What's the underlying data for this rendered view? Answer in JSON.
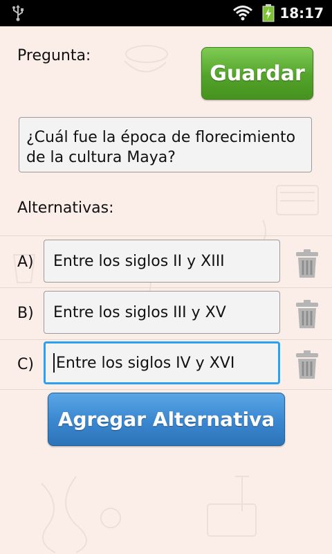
{
  "status_bar": {
    "time": "18:17"
  },
  "form": {
    "question_label": "Pregunta:",
    "save_button": "Guardar",
    "question_text": "¿Cuál fue la época de florecimiento de la cultura Maya?",
    "alternatives_label": "Alternativas:",
    "alternatives": [
      {
        "letter": "A)",
        "value": "Entre los siglos II y XIII"
      },
      {
        "letter": "B)",
        "value": "Entre los siglos III y XV"
      },
      {
        "letter": "C)",
        "value": "Entre los siglos IV y XVI"
      }
    ],
    "add_button": "Agregar Alternativa"
  },
  "colors": {
    "save_button": "#53a32a",
    "add_button": "#3a86cf",
    "focus_border": "#2aa0f0"
  }
}
